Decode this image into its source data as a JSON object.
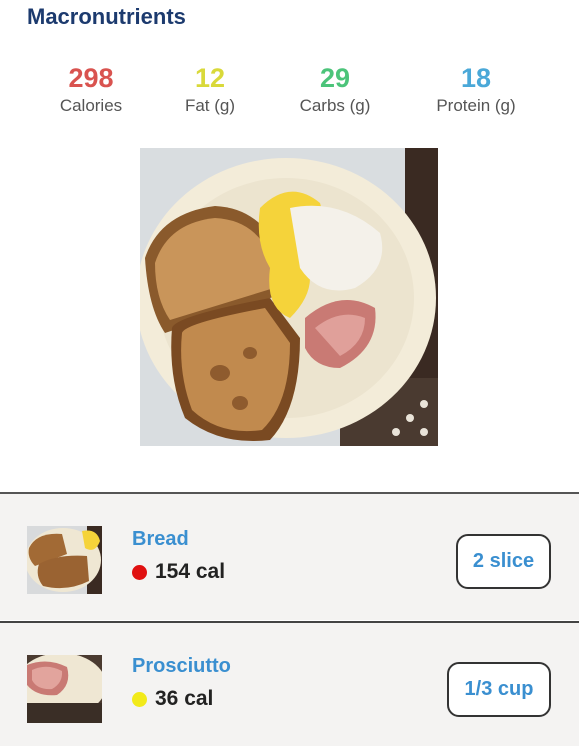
{
  "header": {
    "title": "Macronutrients"
  },
  "macros": [
    {
      "value": "298",
      "label": "Calories",
      "color": "#d9534f"
    },
    {
      "value": "12",
      "label": "Fat (g)",
      "color": "#d9d93a"
    },
    {
      "value": "29",
      "label": "Carbs (g)",
      "color": "#4cc47a"
    },
    {
      "value": "18",
      "label": "Protein (g)",
      "color": "#4aa8d8"
    }
  ],
  "photo": {
    "icon": "meal-photo"
  },
  "items": [
    {
      "name": "Bread",
      "calories": "154 cal",
      "dot_color": "#e01010",
      "quantity": "2 slice",
      "icon": "bread-thumbnail"
    },
    {
      "name": "Prosciutto",
      "calories": "36 cal",
      "dot_color": "#f2ea1a",
      "quantity": "1/3 cup",
      "icon": "prosciutto-thumbnail"
    }
  ]
}
